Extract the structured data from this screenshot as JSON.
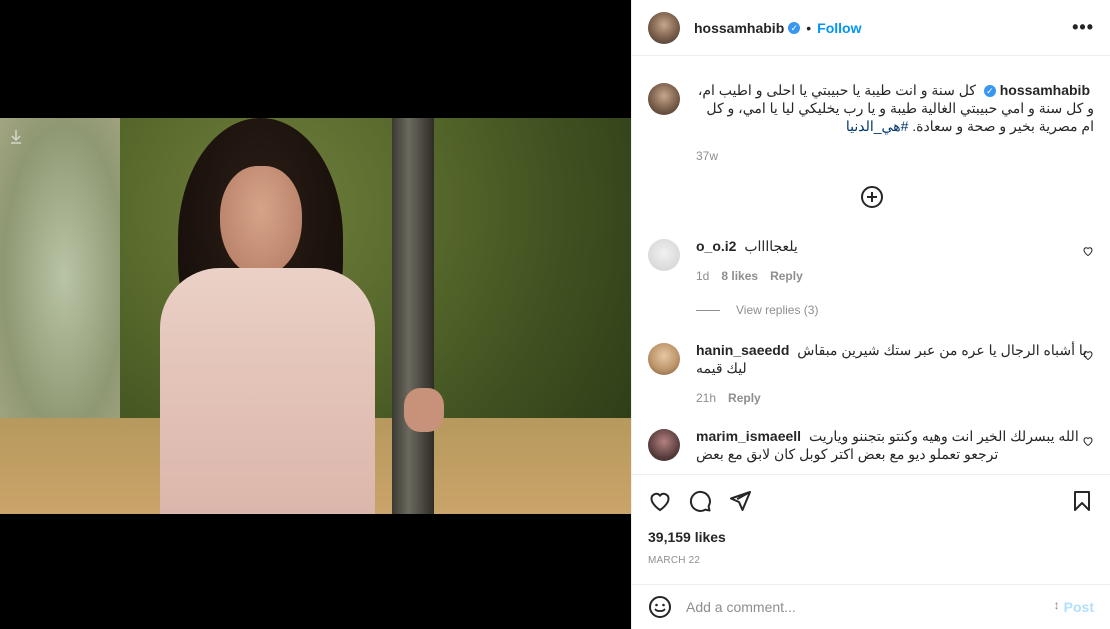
{
  "post": {
    "username": "hossamhabib",
    "follow_label": "Follow",
    "dot": "•",
    "more_label": "•••",
    "verified_mark": "✓"
  },
  "caption": {
    "username": "hossamhabib",
    "text": "كل سنة و انت طيبة يا حبيبتي يا احلى و اطيب ام، و كل سنة و امي حبيبتي الغالية طيبة و يا رب يخليكي ليا يا امي، و كل ام مصرية بخير و صحة و سعادة.",
    "hashtag": "#هي_الدنيا",
    "time": "37w"
  },
  "comments": [
    {
      "username": "o_o.i2",
      "text": "يلعجااااب",
      "time": "1d",
      "likes": "8 likes",
      "reply_label": "Reply",
      "view_replies": "View replies (3)"
    },
    {
      "username": "hanin_saeedd",
      "text": "يا أشباه الرجال يا عره من عبر ستك شيرين مبقاش ليك قيمه",
      "time": "21h",
      "reply_label": "Reply"
    },
    {
      "username": "marim_ismaeell",
      "text": "الله يبسرلك الخير انت وهيه وكنتو بتجننو وياريت ترجعو تعملو ديو مع بعض اكتر كوبل كان لابق مع بعض"
    }
  ],
  "engagement": {
    "likes": "39,159 likes",
    "date": "MARCH 22"
  },
  "add_comment": {
    "placeholder": "Add a comment...",
    "post_label": "Post"
  },
  "colors": {
    "accent": "#0095f6",
    "verified": "#3897f0",
    "muted": "#8e8e8e",
    "post_disabled": "#b2dffc"
  }
}
